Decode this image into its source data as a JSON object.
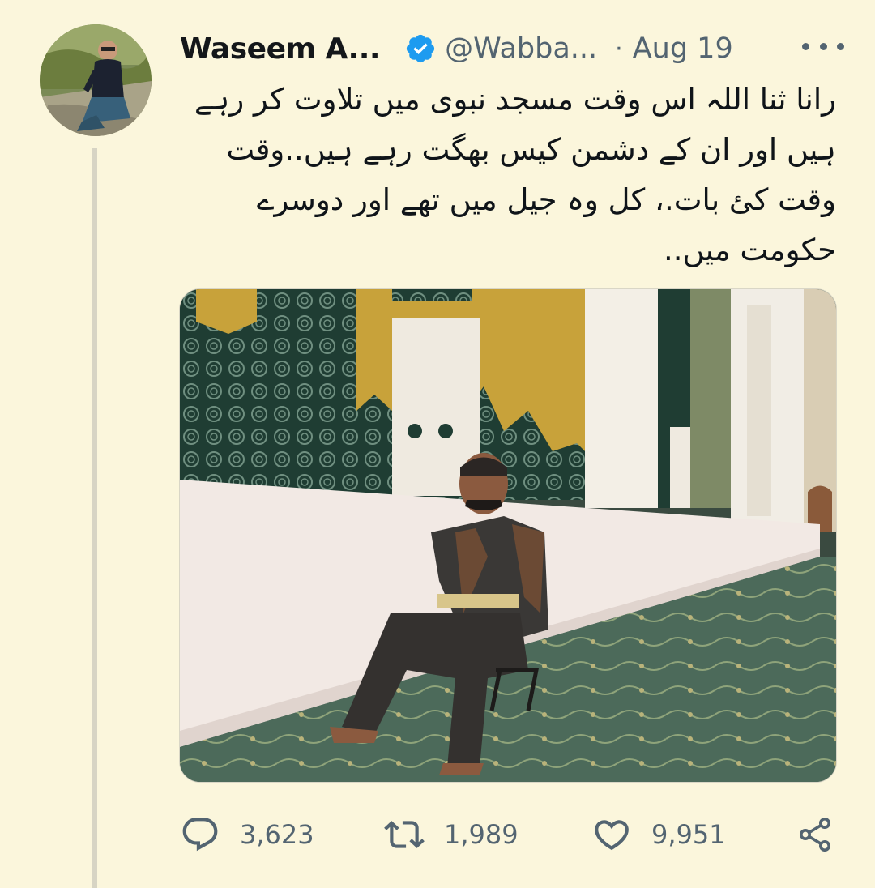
{
  "tweet": {
    "display_name": "Waseem A...",
    "handle": "@Wabba...",
    "separator": "·",
    "date": "Aug 19",
    "text": "رانا ثنا اللہ اس وقت مسجد نبوی میں تلاوت کر رہے ہیں اور ان کے دشمن کیس بھگت رہے ہیں..وقت وقت کئ بات.، کل وہ جیل میں تھے اور دوسرے حکومت میں..",
    "replies": "3,623",
    "retweets": "1,989",
    "likes": "9,951"
  },
  "icons": {
    "verified": "verified-badge-icon",
    "more": "more-horizontal-icon",
    "reply": "reply-icon",
    "retweet": "retweet-icon",
    "like": "heart-icon",
    "share": "share-icon"
  },
  "colors": {
    "background": "#fbf6dc",
    "verified": "#1d9bf0",
    "secondary_text": "#536471"
  }
}
